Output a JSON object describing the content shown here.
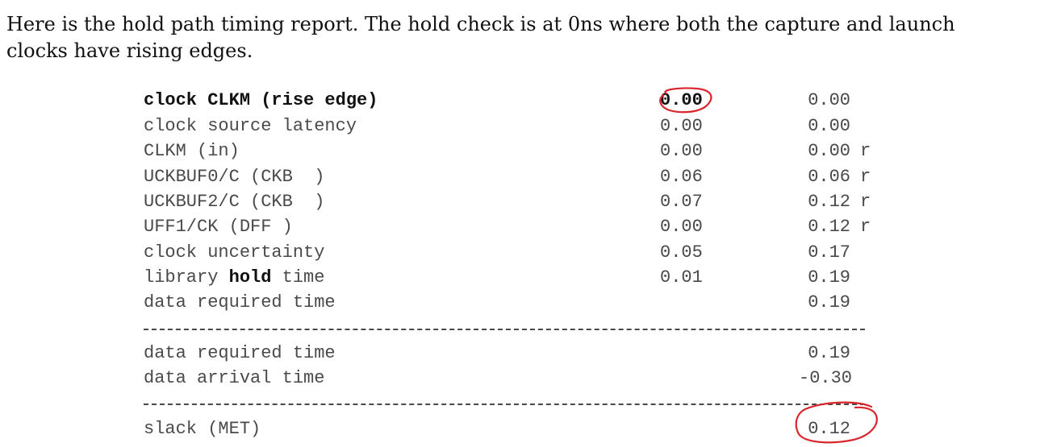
{
  "intro": {
    "line1": "Here is the hold path timing report. The hold check is at 0ns where both the capture and launch",
    "line2": "clocks have rising edges."
  },
  "report": {
    "rows": [
      {
        "label": "clock CLKM (rise edge)",
        "incr": "0.00",
        "path": "0.00",
        "flag": ""
      },
      {
        "label": "clock source latency",
        "incr": "0.00",
        "path": "0.00",
        "flag": ""
      },
      {
        "label": "CLKM (in)",
        "incr": "0.00",
        "path": "0.00",
        "flag": "r"
      },
      {
        "label": "UCKBUF0/C (CKB  )",
        "incr": "0.06",
        "path": "0.06",
        "flag": "r"
      },
      {
        "label": "UCKBUF2/C (CKB  )",
        "incr": "0.07",
        "path": "0.12",
        "flag": "r"
      },
      {
        "label": "UFF1/CK (DFF )",
        "incr": "0.00",
        "path": "0.12",
        "flag": "r"
      },
      {
        "label": "clock uncertainty",
        "incr": "0.05",
        "path": "0.17",
        "flag": ""
      },
      {
        "label_pre": "library ",
        "label_bold": "hold",
        "label_post": " time",
        "incr": "0.01",
        "path": "0.19",
        "flag": ""
      },
      {
        "label": "data required time",
        "incr": "",
        "path": "0.19",
        "flag": ""
      }
    ],
    "summary": [
      {
        "label": "data required time",
        "path": "0.19"
      },
      {
        "label": "data arrival time",
        "path": "-0.30"
      }
    ],
    "slack": {
      "label": "slack (MET)",
      "path": "0.12"
    }
  },
  "colors": {
    "annotation": "#d8262c",
    "report_text": "#4a4a4a"
  }
}
